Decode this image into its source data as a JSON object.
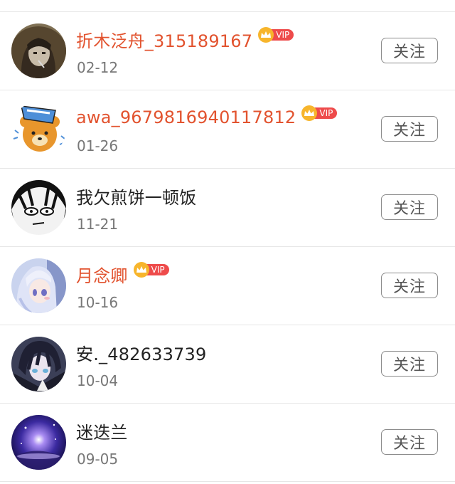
{
  "follow_list": {
    "items": [
      {
        "name": "折木泛舟_315189167",
        "date": "02-12",
        "vip": true,
        "vip_label": "VIP",
        "follow_label": "关注",
        "avatar": "hooded-anime-avatar"
      },
      {
        "name": "awa_9679816940117812",
        "date": "01-26",
        "vip": true,
        "vip_label": "VIP",
        "follow_label": "关注",
        "avatar": "rilakkuma-bear-avatar"
      },
      {
        "name": "我欠煎饼一顿饭",
        "date": "11-21",
        "vip": false,
        "follow_label": "关注",
        "avatar": "manga-face-avatar"
      },
      {
        "name": "月念卿",
        "date": "10-16",
        "vip": true,
        "vip_label": "VIP",
        "follow_label": "关注",
        "avatar": "silver-hair-anime-girl-avatar"
      },
      {
        "name": "安._482633739",
        "date": "10-04",
        "vip": false,
        "follow_label": "关注",
        "avatar": "dark-hair-anime-boy-avatar"
      },
      {
        "name": "迷迭兰",
        "date": "09-05",
        "vip": false,
        "follow_label": "关注",
        "avatar": "purple-galaxy-avatar"
      }
    ]
  },
  "colors": {
    "vip_name": "#e2532f",
    "normal_name": "#222222",
    "date": "#777777",
    "vip_badge": "#ee4b4b",
    "crown": "#f7b52c",
    "divider": "#e6e6e6"
  }
}
